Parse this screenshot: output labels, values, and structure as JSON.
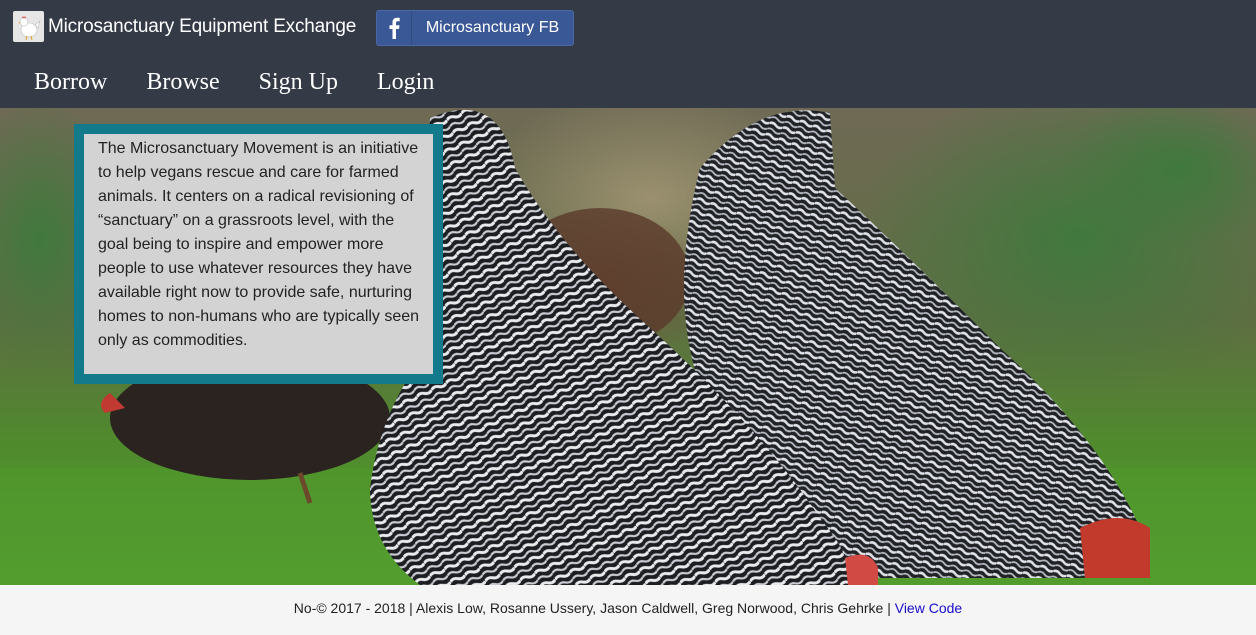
{
  "header": {
    "brand_title": "Microsanctuary Equipment Exchange",
    "logo_icon": "chicken-logo-icon",
    "fb_button": {
      "icon": "facebook-icon",
      "label": "Microsanctuary FB"
    }
  },
  "nav": {
    "items": [
      {
        "label": "Borrow"
      },
      {
        "label": "Browse"
      },
      {
        "label": "Sign Up"
      },
      {
        "label": "Login"
      }
    ]
  },
  "hero": {
    "image": "hens-foraging-in-grass",
    "intro_text": "The Microsanctuary Movement is an initiative to help vegans rescue and care for farmed animals. It centers on a radical revisioning of “sanctuary” on a grassroots level, with the goal being to inspire and empower more people to use whatever resources they have available right now to provide safe, nurturing homes to non-humans who are typically seen only as commodities."
  },
  "footer": {
    "credits": "No-© 2017 - 2018 | Alexis Low, Rosanne Ussery, Jason Caldwell, Greg Norwood, Chris Gehrke | ",
    "view_code_label": "View Code"
  },
  "colors": {
    "header_bg": "#343a46",
    "fb_blue": "#3b5896",
    "box_border": "#137a8b",
    "box_bg": "#d3d3d3",
    "link": "#1a0dcc"
  }
}
